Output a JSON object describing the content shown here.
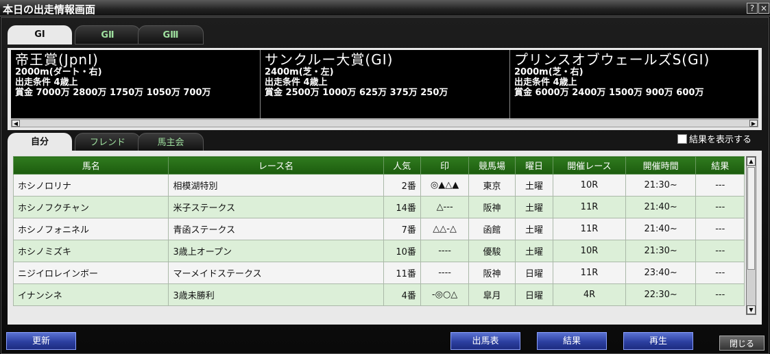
{
  "window": {
    "title": "本日の出走情報画面",
    "help_label": "?",
    "close_label": "×"
  },
  "grade_tabs": [
    "GⅠ",
    "GⅡ",
    "GⅢ"
  ],
  "races": [
    {
      "name": "帝王賞(JpnⅠ)",
      "course": "2000m(ダート・右)",
      "condition": "出走条件 4歳上",
      "prize": "賞金 7000万 2800万 1750万 1050万 700万"
    },
    {
      "name": "サンクルー大賞(GⅠ)",
      "course": "2400m(芝・左)",
      "condition": "出走条件 4歳上",
      "prize": "賞金 2500万 1000万 625万 375万 250万"
    },
    {
      "name": "プリンスオブウェールズS(GⅠ)",
      "course": "2000m(芝・右)",
      "condition": "出走条件 4歳上",
      "prize": "賞金 6000万 2400万 1500万 900万 600万"
    }
  ],
  "owner_tabs": [
    "自分",
    "フレンド",
    "馬主会"
  ],
  "show_results_label": "結果を表示する",
  "columns": [
    "馬名",
    "レース名",
    "人気",
    "印",
    "競馬場",
    "曜日",
    "開催レース",
    "開催時間",
    "結果"
  ],
  "rows": [
    {
      "horse": "ホシノロリナ",
      "race": "相模湖特別",
      "pop": "2番",
      "mark": "◎▲△▲",
      "track": "東京",
      "day": "土曜",
      "rno": "10R",
      "time": "21:30~",
      "result": "---"
    },
    {
      "horse": "ホシノフクチャン",
      "race": "米子ステークス",
      "pop": "14番",
      "mark": "△---",
      "track": "阪神",
      "day": "土曜",
      "rno": "11R",
      "time": "21:40~",
      "result": "---"
    },
    {
      "horse": "ホシノフォニネル",
      "race": "青函ステークス",
      "pop": "7番",
      "mark": "△△-△",
      "track": "函館",
      "day": "土曜",
      "rno": "11R",
      "time": "21:40~",
      "result": "---"
    },
    {
      "horse": "ホシノミズキ",
      "race": "3歳上オープン",
      "pop": "10番",
      "mark": "----",
      "track": "優駿",
      "day": "土曜",
      "rno": "10R",
      "time": "21:30~",
      "result": "---"
    },
    {
      "horse": "ニジイロレインボー",
      "race": "マーメイドステークス",
      "pop": "11番",
      "mark": "----",
      "track": "阪神",
      "day": "日曜",
      "rno": "11R",
      "time": "23:40~",
      "result": "---"
    },
    {
      "horse": "イナンシネ",
      "race": "3歳未勝利",
      "pop": "4番",
      "mark": "-◎○△",
      "track": "皐月",
      "day": "日曜",
      "rno": "4R",
      "time": "22:30~",
      "result": "---"
    }
  ],
  "buttons": {
    "refresh": "更新",
    "entry_table": "出馬表",
    "results": "結果",
    "replay": "再生",
    "close": "閉じる"
  }
}
